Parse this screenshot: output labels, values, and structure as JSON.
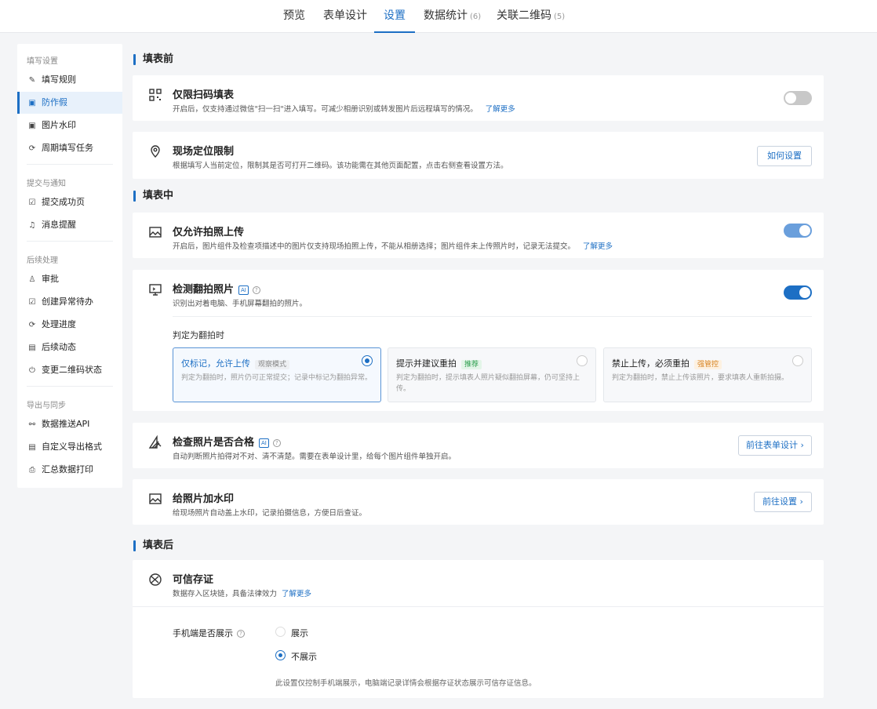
{
  "topnav": {
    "tabs": [
      {
        "label": "预览",
        "count": ""
      },
      {
        "label": "表单设计",
        "count": ""
      },
      {
        "label": "设置",
        "count": ""
      },
      {
        "label": "数据统计",
        "count": "(6)"
      },
      {
        "label": "关联二维码",
        "count": "(5)"
      }
    ],
    "active_tab": "设置"
  },
  "sidebar": {
    "groups": [
      {
        "title": "填写设置",
        "items": [
          {
            "label": "填写规则",
            "icon": "edit-icon"
          },
          {
            "label": "防作假",
            "icon": "image-icon",
            "active": true
          },
          {
            "label": "图片水印",
            "icon": "image-icon"
          },
          {
            "label": "周期填写任务",
            "icon": "cycle-icon"
          }
        ]
      },
      {
        "title": "提交与通知",
        "items": [
          {
            "label": "提交成功页",
            "icon": "check-doc-icon"
          },
          {
            "label": "消息提醒",
            "icon": "bell-icon"
          }
        ]
      },
      {
        "title": "后续处理",
        "items": [
          {
            "label": "审批",
            "icon": "stamp-icon"
          },
          {
            "label": "创建异常待办",
            "icon": "todo-icon"
          },
          {
            "label": "处理进度",
            "icon": "cycle-icon"
          },
          {
            "label": "后续动态",
            "icon": "doc-icon"
          },
          {
            "label": "变更二维码状态",
            "icon": "power-icon"
          }
        ]
      },
      {
        "title": "导出与同步",
        "items": [
          {
            "label": "数据推送API",
            "icon": "link-icon"
          },
          {
            "label": "自定义导出格式",
            "icon": "export-icon"
          },
          {
            "label": "汇总数据打印",
            "icon": "printer-icon"
          }
        ]
      }
    ]
  },
  "sections": {
    "before": "填表前",
    "during": "填表中",
    "after": "填表后"
  },
  "cards": {
    "scan_only": {
      "title": "仅限扫码填表",
      "desc": "开启后，仅支持通过微信\"扫一扫\"进入填写。可减少相册识别或转发图片后远程填写的情况。",
      "link": "了解更多",
      "enabled": false
    },
    "location": {
      "title": "现场定位限制",
      "desc": "根据填写人当前定位，限制其是否可打开二维码。该功能需在其他页面配置，点击右侧查看设置方法。",
      "button": "如何设置"
    },
    "photo_only": {
      "title": "仅允许拍照上传",
      "desc": "开启后，图片组件及检查项描述中的图片仅支持现场拍照上传，不能从相册选择；图片组件未上传照片时，记录无法提交。",
      "link": "了解更多",
      "enabled": true
    },
    "retake": {
      "title": "检测翻拍照片",
      "ai_badge": "AI",
      "desc": "识别出对着电脑、手机屏幕翻拍的照片。",
      "enabled": true,
      "judge_label": "判定为翻拍时",
      "options": [
        {
          "title": "仅标记，允许上传",
          "tag": "观察模式",
          "desc": "判定为翻拍时，照片仍可正常提交；记录中标记为翻拍异常。",
          "selected": true
        },
        {
          "title": "提示并建议重拍",
          "tag": "推荐",
          "desc": "判定为翻拍时，提示填表人照片疑似翻拍屏幕，仍可坚持上传。",
          "selected": false
        },
        {
          "title": "禁止上传，必须重拍",
          "tag": "强管控",
          "desc": "判定为翻拍时，禁止上传该照片，要求填表人重新拍摄。",
          "selected": false
        }
      ]
    },
    "quality": {
      "title": "检查照片是否合格",
      "ai_badge": "AI",
      "desc": "自动判断照片拍得对不对、清不清楚。需要在表单设计里，给每个图片组件单独开启。",
      "button": "前往表单设计 ›"
    },
    "watermark": {
      "title": "给照片加水印",
      "desc": "给现场照片自动盖上水印，记录拍摄信息，方便日后查证。",
      "button": "前往设置 ›"
    },
    "evidence": {
      "title": "可信存证",
      "desc": "数据存入区块链，具备法律效力",
      "link": "了解更多",
      "mobile_label": "手机端是否展示",
      "options": [
        {
          "label": "展示",
          "selected": false
        },
        {
          "label": "不展示",
          "selected": true
        }
      ],
      "note": "此设置仅控制手机端展示，电脑端记录详情会根据存证状态展示可信存证信息。"
    }
  },
  "colors": {
    "accent": "#1d6fc4",
    "toggle_off": "#c8c8c8",
    "background": "#f4f5f7"
  }
}
